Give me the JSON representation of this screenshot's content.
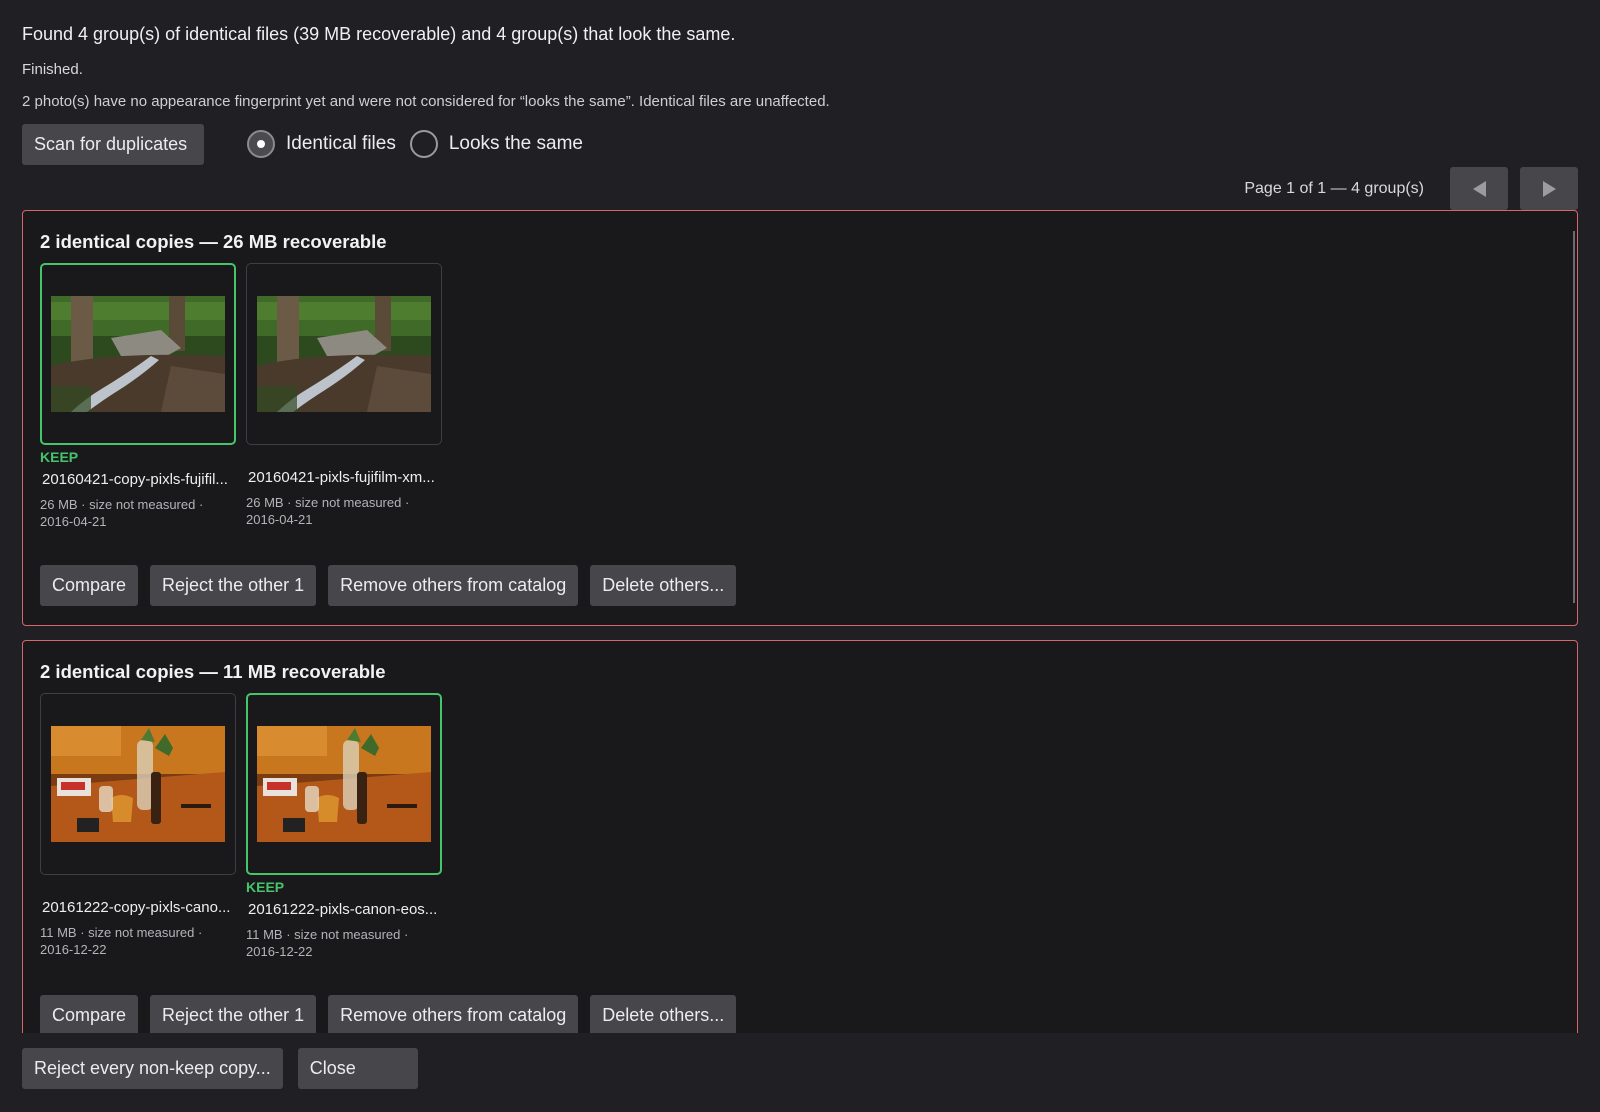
{
  "summary": "Found 4 group(s) of identical files (39 MB recoverable) and 4 group(s) that look the same.",
  "status": "Finished.",
  "notice": "2 photo(s) have no appearance fingerprint yet and were not considered for “looks the same”. Identical files are unaffected.",
  "scan_button": "Scan for duplicates",
  "mode": {
    "options": [
      {
        "label": "Identical files",
        "selected": true
      },
      {
        "label": "Looks the same",
        "selected": false
      }
    ]
  },
  "pager": {
    "text": "Page 1 of 1 — 4 group(s)",
    "prev_icon": "triangle-left-icon",
    "next_icon": "triangle-right-icon"
  },
  "colors": {
    "group_border": "#d9656b",
    "keep": "#46c46a",
    "button_bg": "#46464b",
    "background": "#202024"
  },
  "groups": [
    {
      "title": "2 identical copies — 26 MB recoverable",
      "files": [
        {
          "keep": true,
          "keep_label": "KEEP",
          "filename": "20160421-copy-pixls-fujifil...",
          "meta": "26 MB · size not measured · 2016-04-21",
          "thumbnail": "waterfall-forest-photo"
        },
        {
          "keep": false,
          "keep_label": "",
          "filename": "20160421-pixls-fujifilm-xm...",
          "meta": "26 MB · size not measured · 2016-04-21",
          "thumbnail": "waterfall-forest-photo"
        }
      ],
      "actions": {
        "compare": "Compare",
        "reject": "Reject the other 1",
        "remove": "Remove others from catalog",
        "delete": "Delete others..."
      }
    },
    {
      "title": "2 identical copies — 11 MB recoverable",
      "files": [
        {
          "keep": false,
          "keep_label": "",
          "filename": "20161222-copy-pixls-cano...",
          "meta": "11 MB · size not measured · 2016-12-22",
          "thumbnail": "table-bottles-photo"
        },
        {
          "keep": true,
          "keep_label": "KEEP",
          "filename": "20161222-pixls-canon-eos...",
          "meta": "11 MB · size not measured · 2016-12-22",
          "thumbnail": "table-bottles-photo"
        }
      ],
      "actions": {
        "compare": "Compare",
        "reject": "Reject the other 1",
        "remove": "Remove others from catalog",
        "delete": "Delete others..."
      }
    }
  ],
  "footer": {
    "reject_all": "Reject every non-keep copy...",
    "close": "Close"
  }
}
